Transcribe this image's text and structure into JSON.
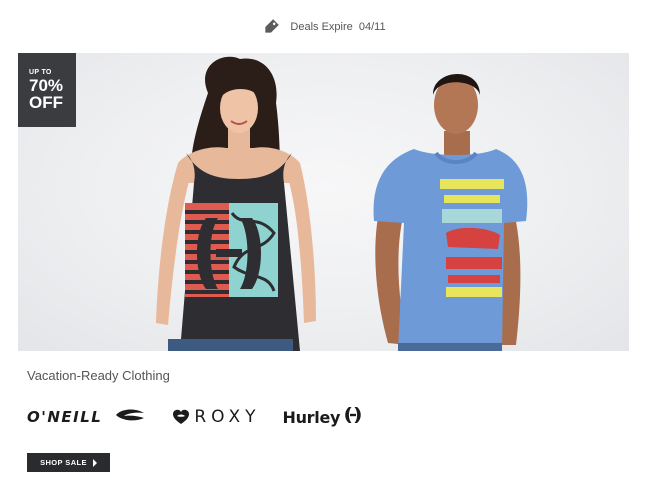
{
  "header": {
    "deals_text": "Deals Expire  04/11",
    "tag_icon": "tag-icon"
  },
  "hero": {
    "badge": {
      "up_to": "UP TO",
      "percent": "70%",
      "off": "OFF"
    },
    "model_left": {
      "shirt_print": "hurley-stripe-tank"
    },
    "model_right": {
      "shirt_print": "BROOKLYN MANHATTAN bronx QUEENS STATEN ISLAND"
    }
  },
  "headline": "Vacation-Ready Clothing",
  "brands": {
    "oneill": "O'NEILL",
    "roxy": "ROXY",
    "hurley": "Hurley"
  },
  "cta": {
    "label": "SHOP SALE"
  },
  "colors": {
    "badge_bg": "#3a3c40",
    "button_bg": "#2a2b2e",
    "tee_blue": "#6f9ad8",
    "tank_stripe": "#e15a4f"
  }
}
